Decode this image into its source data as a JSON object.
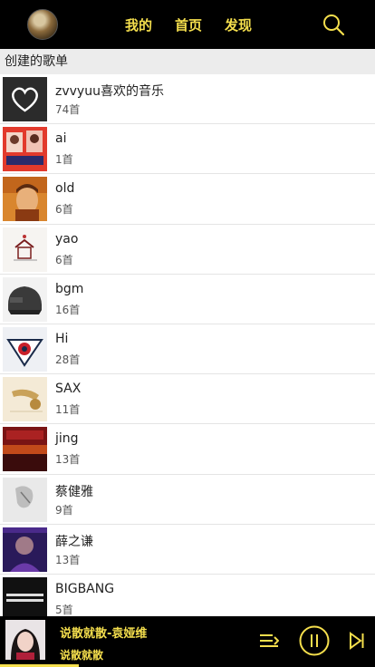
{
  "nav": {
    "mine": "我的",
    "home": "首页",
    "discover": "发现"
  },
  "colors": {
    "accent": "#f5df4d",
    "bar": "#000000",
    "header_bg": "#ececec"
  },
  "section": {
    "title": "创建的歌单"
  },
  "playlists": [
    {
      "name": "zvvyuu喜欢的音乐",
      "count": "74首",
      "cover_icon": "heart-icon"
    },
    {
      "name": "ai",
      "count": "1首"
    },
    {
      "name": "old",
      "count": "6首"
    },
    {
      "name": "yao",
      "count": "6首"
    },
    {
      "name": "bgm",
      "count": "16首"
    },
    {
      "name": "Hi",
      "count": "28首"
    },
    {
      "name": "SAX",
      "count": "11首"
    },
    {
      "name": "jing",
      "count": "13首"
    },
    {
      "name": "蔡健雅",
      "count": "9首"
    },
    {
      "name": "薛之谦",
      "count": "13首"
    },
    {
      "name": "BIGBANG",
      "count": "5首"
    }
  ],
  "player": {
    "title": "说散就散-袁娅维",
    "subtitle": "说散就散",
    "progress_fraction": 0.21
  }
}
